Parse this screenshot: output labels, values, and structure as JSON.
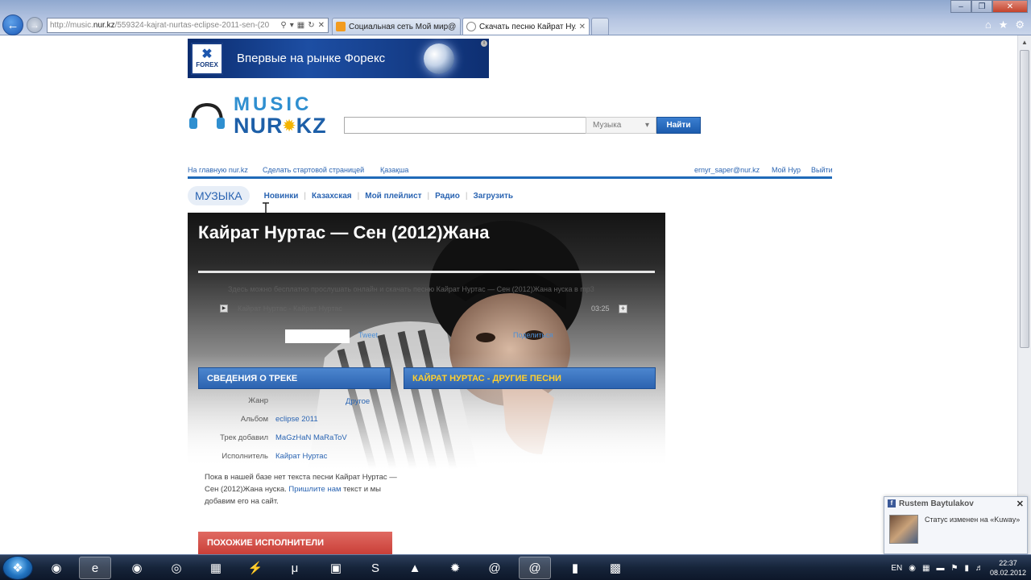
{
  "browser": {
    "url_prefix": "http://music.",
    "url_host": "nur.kz",
    "url_rest": "/559324-kajrat-nurtas-eclipse-2011-sen-(20",
    "tabs": [
      {
        "label": "Социальная сеть Мой мир@...",
        "active": false
      },
      {
        "label": "Скачать песню Кайрат Ну...",
        "active": true
      }
    ]
  },
  "banner": {
    "logo_text": "FOREX",
    "text": "Впервые на рынке Форекс"
  },
  "site": {
    "logo_top": "MUSIC",
    "logo_bottom_left": "NUR",
    "logo_bottom_right": "KZ"
  },
  "search": {
    "value": "",
    "category": "Музыка",
    "button": "Найти"
  },
  "topnav": {
    "home": "На главную nur.kz",
    "start_page": "Сделать стартовой страницей",
    "kazakh": "Қазақша",
    "email": "ernyr_saper@nur.kz",
    "my_nur": "Мой Нур",
    "logout": "Выйти"
  },
  "subnav": {
    "section": "МУЗЫКА",
    "items": [
      "Новинки",
      "Казахская",
      "Мой плейлист",
      "Радио",
      "Загрузить"
    ]
  },
  "track": {
    "title": "Кайрат Нуртас — Сен (2012)Жана",
    "description": "Здесь можно бесплатно прослушать онлайн и скачать песню Кайрат Нуртас — Сен (2012)Жана нуска в mp3",
    "player_label": "Кайрат Нуртас - Кайрат Нуртас",
    "duration": "03:25",
    "tweet": "Tweet",
    "share": "Поделиться"
  },
  "info_panel": {
    "title": "СВЕДЕНИЯ О ТРЕКЕ",
    "other_title": "КАЙРАТ НУРТАС - ДРУГИЕ ПЕСНИ",
    "other_link": "Другое",
    "rows": [
      {
        "key": "Жанр",
        "value": ""
      },
      {
        "key": "Альбом",
        "value": "eclipse 2011"
      },
      {
        "key": "Трек добавил",
        "value": "MaGzHaN MaRaToV"
      },
      {
        "key": "Исполнитель",
        "value": "Кайрат Нуртас"
      }
    ]
  },
  "lyrics": {
    "text_before": "Пока в нашей базе нет текста песни Кайрат Нуртас — Сен (2012)Жана нуска.",
    "link": "Пришлите нам",
    "text_after": "текст и мы добавим его на сайт."
  },
  "similar": {
    "title": "ПОХОЖИЕ ИСПОЛНИТЕЛИ"
  },
  "notification": {
    "name": "Rustem Baytulakov",
    "message": "Статус изменен на «Kuway»"
  },
  "taskbar": {
    "lang": "EN",
    "time": "22:37",
    "date": "08.02.2012"
  }
}
